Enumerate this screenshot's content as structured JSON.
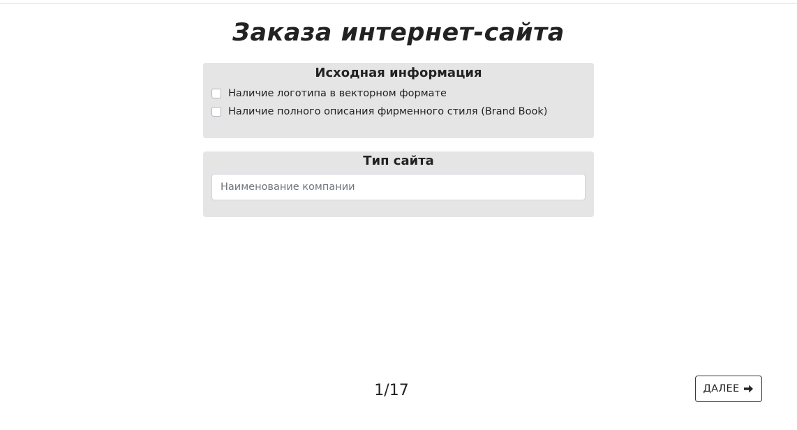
{
  "page": {
    "title": "Заказа интернет-сайта"
  },
  "source_info": {
    "heading": "Исходная информация",
    "options": [
      {
        "label": "Наличие логотипа в векторном формате",
        "checked": false
      },
      {
        "label": "Наличие полного описания фирменного стиля (Brand Book)",
        "checked": false
      }
    ]
  },
  "site_type": {
    "heading": "Тип сайта",
    "company_input": {
      "placeholder": "Наименование компании",
      "value": ""
    }
  },
  "pagination": {
    "label": "1/17",
    "current": 1,
    "total": 17
  },
  "navigation": {
    "next_label": "ДАЛЕЕ",
    "next_icon": "arrow-right-icon"
  },
  "colors": {
    "card_background": "#e5e5e5",
    "text": "#222222",
    "placeholder": "#6c757d"
  }
}
